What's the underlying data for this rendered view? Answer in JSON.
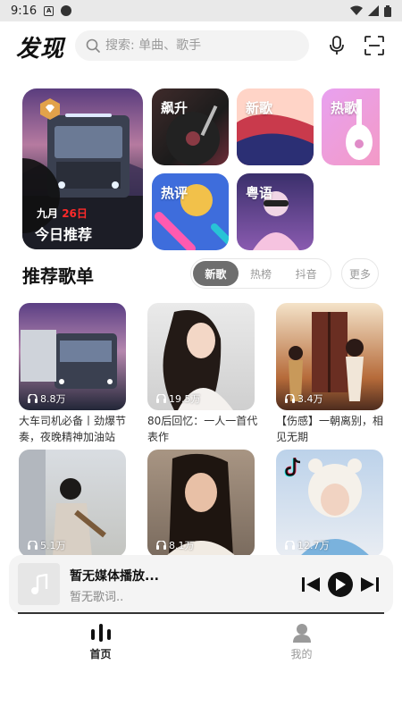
{
  "status": {
    "time": "9:16"
  },
  "header": {
    "logo": "发现",
    "search_placeholder": "搜索: 单曲、歌手"
  },
  "featured": {
    "month": "九月",
    "day": "26日",
    "title": "今日推荐"
  },
  "tiles": [
    {
      "label": "飙升"
    },
    {
      "label": "新歌"
    },
    {
      "label": "热歌"
    },
    {
      "label": "热评"
    },
    {
      "label": "粤语"
    }
  ],
  "section": {
    "title": "推荐歌单",
    "tabs": [
      "新歌",
      "热榜",
      "抖音"
    ],
    "active_tab": "新歌",
    "more": "更多"
  },
  "playlists": [
    {
      "plays": "8.8万",
      "name": "大车司机必备丨劲爆节奏，夜晚精神加油站"
    },
    {
      "plays": "19.5万",
      "name": "80后回忆：一人一首代表作"
    },
    {
      "plays": "3.4万",
      "name": "【伤感】一朝离别，相见无期"
    },
    {
      "plays": "5.1万",
      "name": ""
    },
    {
      "plays": "8.1万",
      "name": ""
    },
    {
      "plays": "12.7万",
      "name": ""
    }
  ],
  "player": {
    "title": "暂无媒体播放...",
    "lyric": "暂无歌词..",
    "progress": 1.0
  },
  "nav": {
    "home": "首页",
    "mine": "我的"
  }
}
